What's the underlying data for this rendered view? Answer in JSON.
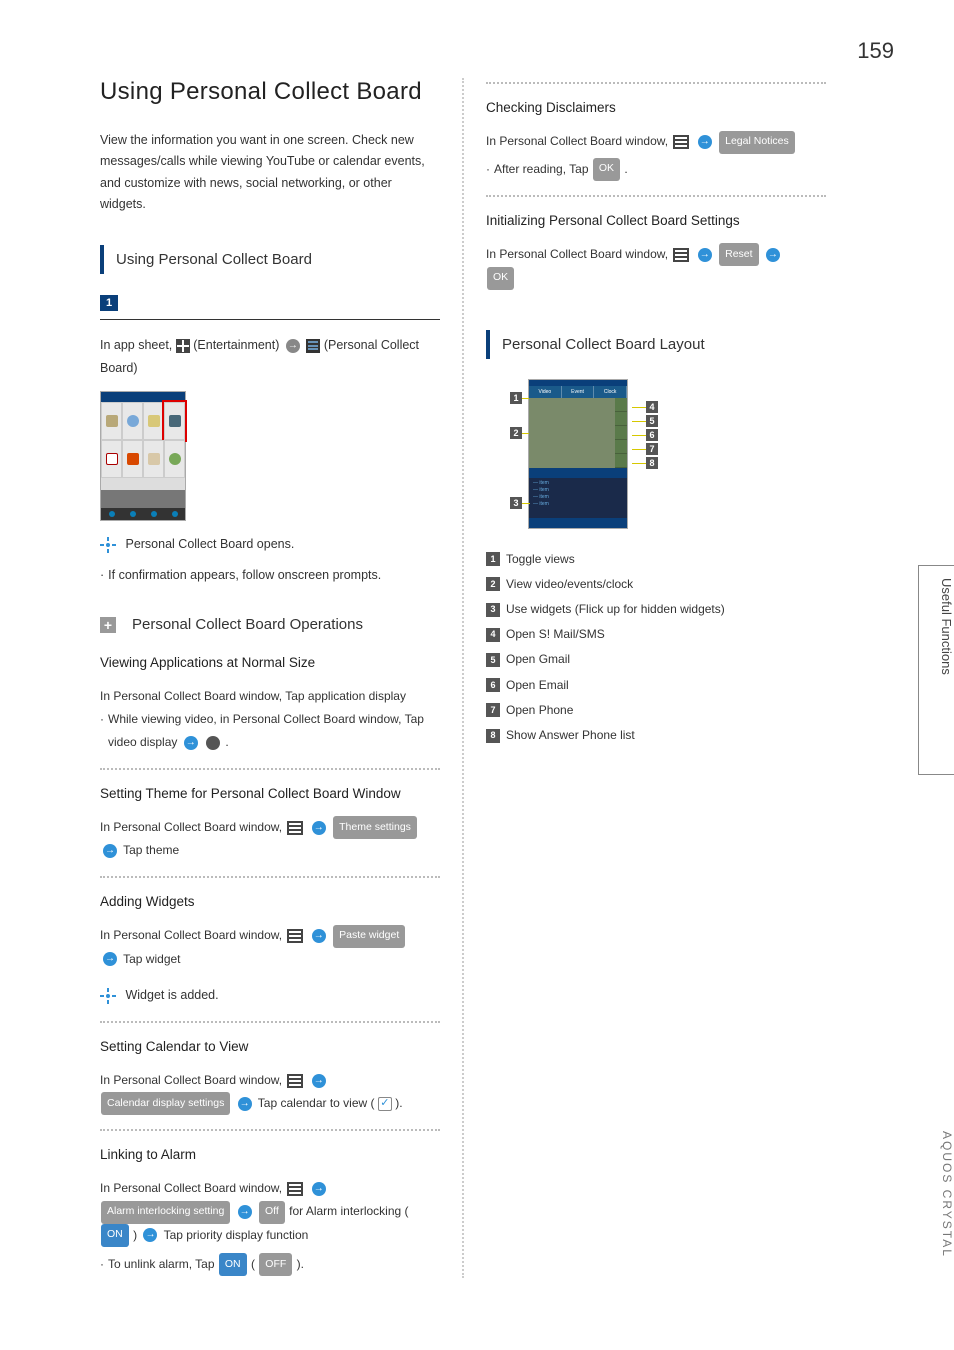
{
  "pageNumber": "159",
  "sideTab": "Useful Functions",
  "sideLabel": "AQUOS CRYSTAL",
  "left": {
    "pageTitle": "Using Personal Collect Board",
    "intro": "View the information you want in one screen.\nCheck new messages/calls while viewing YouTube or calendar events, and customize with news, social networking, or other widgets.",
    "sectionTitle": "Using Personal Collect Board",
    "step1": {
      "num": "1",
      "prefix": "In app sheet, ",
      "afterGrid": " (Entertainment) ",
      "afterArrow": " (Personal Collect Board)"
    },
    "opensLine": "Personal Collect Board opens.",
    "confirmLine": "If confirmation appears, follow onscreen prompts.",
    "opsHeader": "Personal Collect Board Operations",
    "op1": {
      "title": "Viewing Applications at Normal Size",
      "l1": "In Personal Collect Board window, Tap application display",
      "l2": "While viewing video, in Personal Collect Board window, Tap video display ",
      "l2end": " ."
    },
    "op2": {
      "title": "Setting Theme for Personal Collect Board Window",
      "l1": "In Personal Collect Board window, ",
      "btn": "Theme settings",
      "l2": " Tap theme"
    },
    "op3": {
      "title": "Adding Widgets",
      "l1": "In Personal Collect Board window, ",
      "btn": "Paste widget",
      "l2": " Tap widget",
      "result": "Widget is added."
    },
    "op4": {
      "title": "Setting Calendar to View",
      "l1": "In Personal Collect Board window, ",
      "btn": "Calendar display settings",
      "l2": " Tap calendar to view ( ",
      "l2end": " )."
    },
    "op5": {
      "title": "Linking to Alarm",
      "l1": "In Personal Collect Board window, ",
      "btn": "Alarm interlocking setting",
      "off": "Off",
      "mid": " for Alarm interlocking ( ",
      "on": "ON",
      "close": " ) ",
      "tail": " Tap priority display function",
      "unlink1": "To unlink alarm, Tap ",
      "unlinkOn": "ON",
      "unlinkMid": " ( ",
      "unlinkOff": "OFF",
      "unlinkEnd": " )."
    }
  },
  "right": {
    "disc": {
      "title": "Checking Disclaimers",
      "l1": "In Personal Collect Board window, ",
      "btn": "Legal Notices",
      "l2": "After reading, Tap ",
      "ok": "OK",
      "l2end": " ."
    },
    "init": {
      "title": "Initializing Personal Collect Board Settings",
      "l1": "In Personal Collect Board window, ",
      "reset": "Reset",
      "ok": "OK"
    },
    "layout": {
      "header": "Personal Collect Board Layout",
      "items": [
        "Toggle views",
        "View video/events/clock",
        "Use widgets (Flick up for hidden widgets)",
        "Open S! Mail/SMS",
        "Open Gmail",
        "Open Email",
        "Open Phone",
        "Show Answer Phone list"
      ]
    }
  }
}
